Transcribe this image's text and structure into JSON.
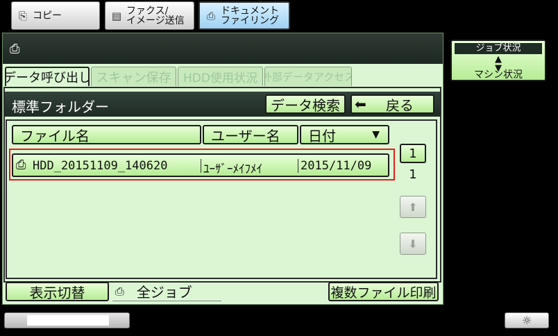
{
  "mode_tabs": [
    {
      "label": "コピー",
      "icon": "copy-icon",
      "active": false
    },
    {
      "label": "ファクス/\nイメージ送信",
      "icon": "fax-icon",
      "active": false
    },
    {
      "label": "ドキュメント\nファイリング",
      "icon": "document-filing-icon",
      "active": true
    }
  ],
  "subtabs": [
    "データ呼び出し",
    "スキャン保存",
    "HDD使用状況",
    "外部データアクセス"
  ],
  "folder": {
    "title": "標準フォルダー",
    "search_label": "データ検索",
    "back_label": "戻る"
  },
  "columns": {
    "file_name": "ファイル名",
    "user_name": "ユーザー名",
    "date": "日付",
    "date_sort": "▼"
  },
  "files": [
    {
      "file_name": "HDD_20151109_140620",
      "user_name": "ﾕｰｻﾞｰﾒｲﾌﾒｲ",
      "date": "2015/11/09",
      "selected": true
    }
  ],
  "pagination": {
    "current": "1",
    "total": "1"
  },
  "bottom": {
    "toggle_label": "表示切替",
    "filter_label": "全ジョブ",
    "multi_print_label": "複数ファイル印刷"
  },
  "side": {
    "job_status": "ジョブ状況",
    "machine_status": "マシン状況"
  },
  "colors": {
    "panel_bg": "#dcf6d4",
    "button_green": "#b6ec95",
    "active_tab": "#9fd2f2",
    "selection_outline": "#e51b1b",
    "title_bar": "#1f2b25"
  }
}
